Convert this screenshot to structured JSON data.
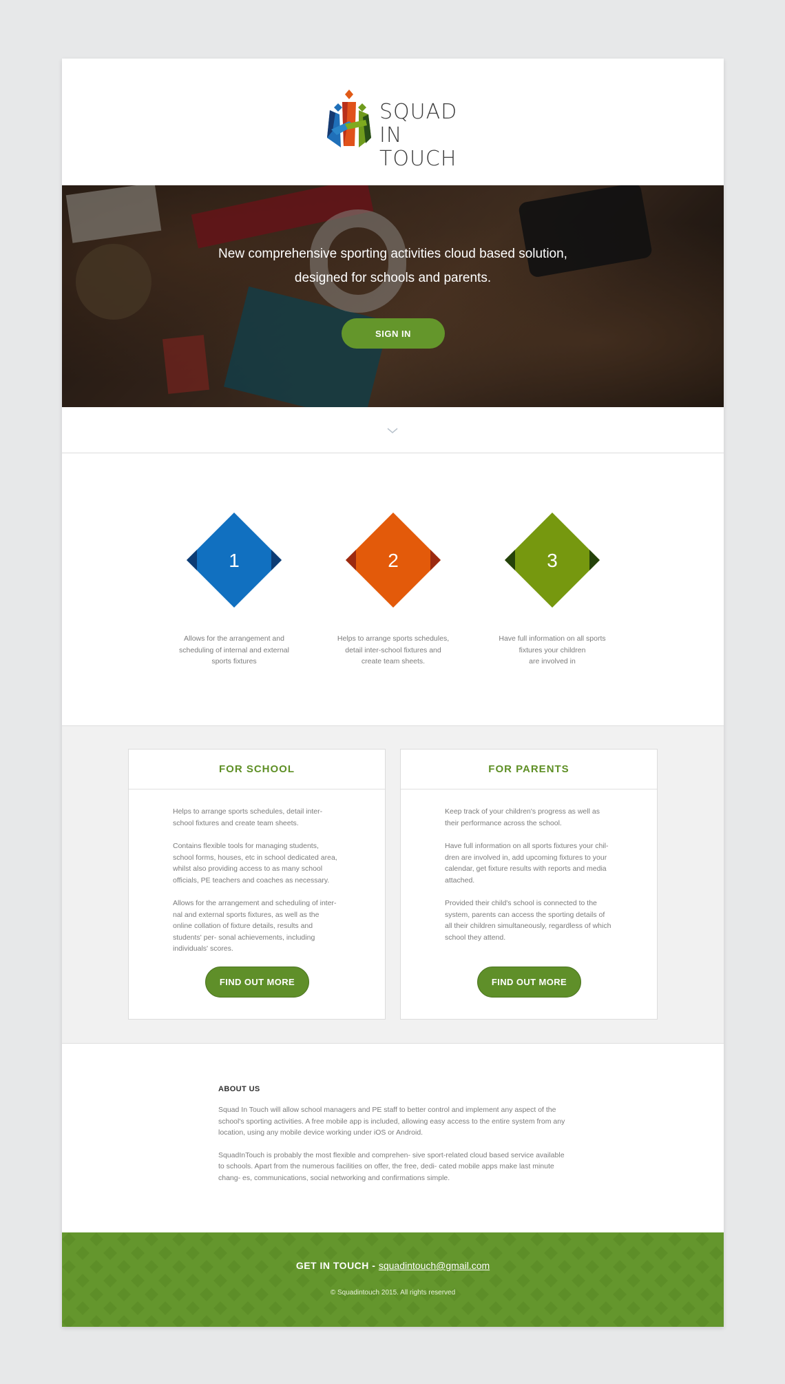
{
  "brand": {
    "line1": "SQUAD",
    "line2": "IN TOUCH",
    "colors": {
      "blue": "#1f6fb8",
      "orange": "#e0521b",
      "green": "#6f9b1d",
      "dark_blue": "#173a70"
    }
  },
  "hero": {
    "tagline_line1": "New comprehensive sporting activities cloud based solution,",
    "tagline_line2": "designed for schools and parents.",
    "signin_label": "SIGN IN"
  },
  "steps": [
    {
      "number": "1",
      "color": "#1170c0",
      "shade": "#0d3c74",
      "line1": "Allows for the arrangement and",
      "line2": "scheduling of internal and external",
      "line3": "sports fixtures"
    },
    {
      "number": "2",
      "color": "#e35a0a",
      "shade": "#9c2a10",
      "line1": "Helps to arrange sports schedules,",
      "line2": "detail inter-school fixtures and",
      "line3": "create team sheets."
    },
    {
      "number": "3",
      "color": "#76980f",
      "shade": "#24420a",
      "line1": "Have full information on all sports",
      "line2": "fixtures your children",
      "line3": "are involved in"
    }
  ],
  "cards": {
    "school": {
      "title": "FOR SCHOOL",
      "p1": "Helps to arrange sports schedules, detail inter-school fixtures and create team sheets.",
      "p2": "Contains flexible tools for managing students, school forms, houses, etc in school dedicated area, whilst also providing access to as many school officials, PE teachers and coaches as necessary.",
      "p3": "Allows for the arrangement and scheduling of inter- nal and external sports fixtures, as well as the online collation of fixture details, results and students' per- sonal achievements, including individuals' scores.",
      "button": "FIND OUT MORE"
    },
    "parents": {
      "title": "FOR PARENTS",
      "p1": "Keep track of your children's progress as well as their performance across the school.",
      "p2": "Have full information on all sports fixtures your chil- dren are involved in, add upcoming fixtures to your calendar, get fixture results with reports and media attached.",
      "p3": "Provided their child's school is connected to the system, parents can access the sporting details of all their children simultaneously, regardless of which school they attend.",
      "button": "FIND OUT MORE"
    }
  },
  "about": {
    "heading": "ABOUT US",
    "p1": "Squad In Touch will allow school managers and PE staff to better control and implement any aspect of the school's sporting activities. A free mobile app is included, allowing easy access to the entire system from any location, using any mobile device working under iOS or Android.",
    "p2": "SquadInTouch is probably the most flexible and comprehen- sive sport-related cloud based service available to schools. Apart from the numerous facilities on offer, the free, dedi- cated mobile apps make last minute chang- es, communications, social networking and confirmations simple."
  },
  "footer": {
    "get_in_touch": "GET IN TOUCH - ",
    "email": "squadintouch@gmail.com",
    "copyright": "© Squadintouch 2015. All rights reserved",
    "color": "#64962d"
  }
}
